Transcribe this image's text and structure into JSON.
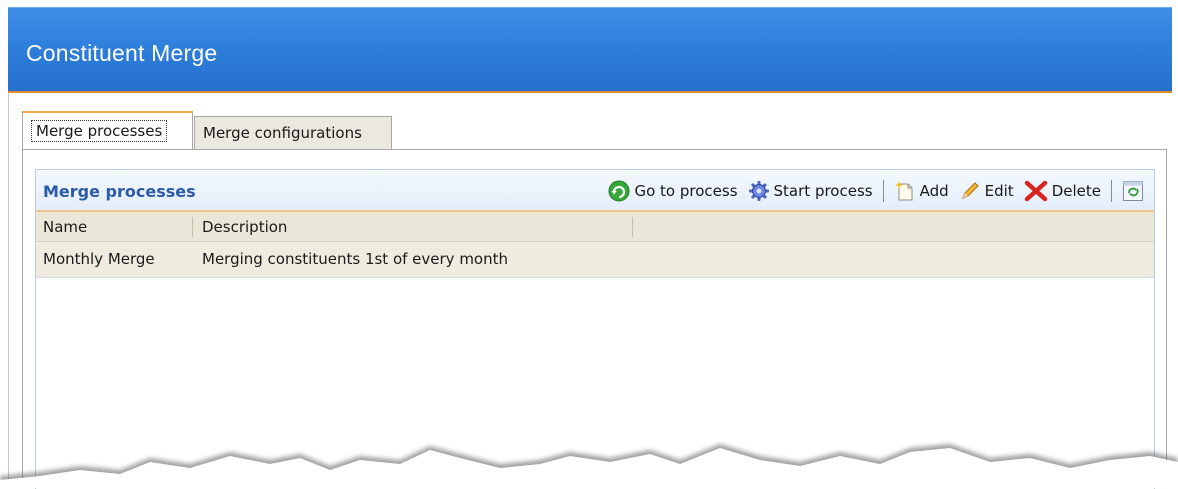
{
  "header": {
    "title": "Constituent Merge"
  },
  "tabs": [
    {
      "label": "Merge processes",
      "active": true
    },
    {
      "label": "Merge configurations",
      "active": false
    }
  ],
  "panel": {
    "title": "Merge processes",
    "actions": {
      "go_to_process": "Go to process",
      "start_process": "Start process",
      "add": "Add",
      "edit": "Edit",
      "delete": "Delete"
    }
  },
  "grid": {
    "columns": [
      "Name",
      "Description"
    ],
    "rows": [
      {
        "name": "Monthly Merge",
        "description": "Merging constituents 1st of every month"
      }
    ]
  },
  "icons": {
    "go_to_process": "green-circular-arrow-icon",
    "start_process": "gear-icon",
    "add": "new-document-sparkle-icon",
    "edit": "pencil-icon",
    "delete": "red-x-icon",
    "refresh": "refresh-icon"
  },
  "colors": {
    "header_blue": "#2f7fdc",
    "header_accent": "#e48a2e",
    "section_title": "#2c5aa8",
    "grid_header_bg": "#ebe7d8"
  }
}
